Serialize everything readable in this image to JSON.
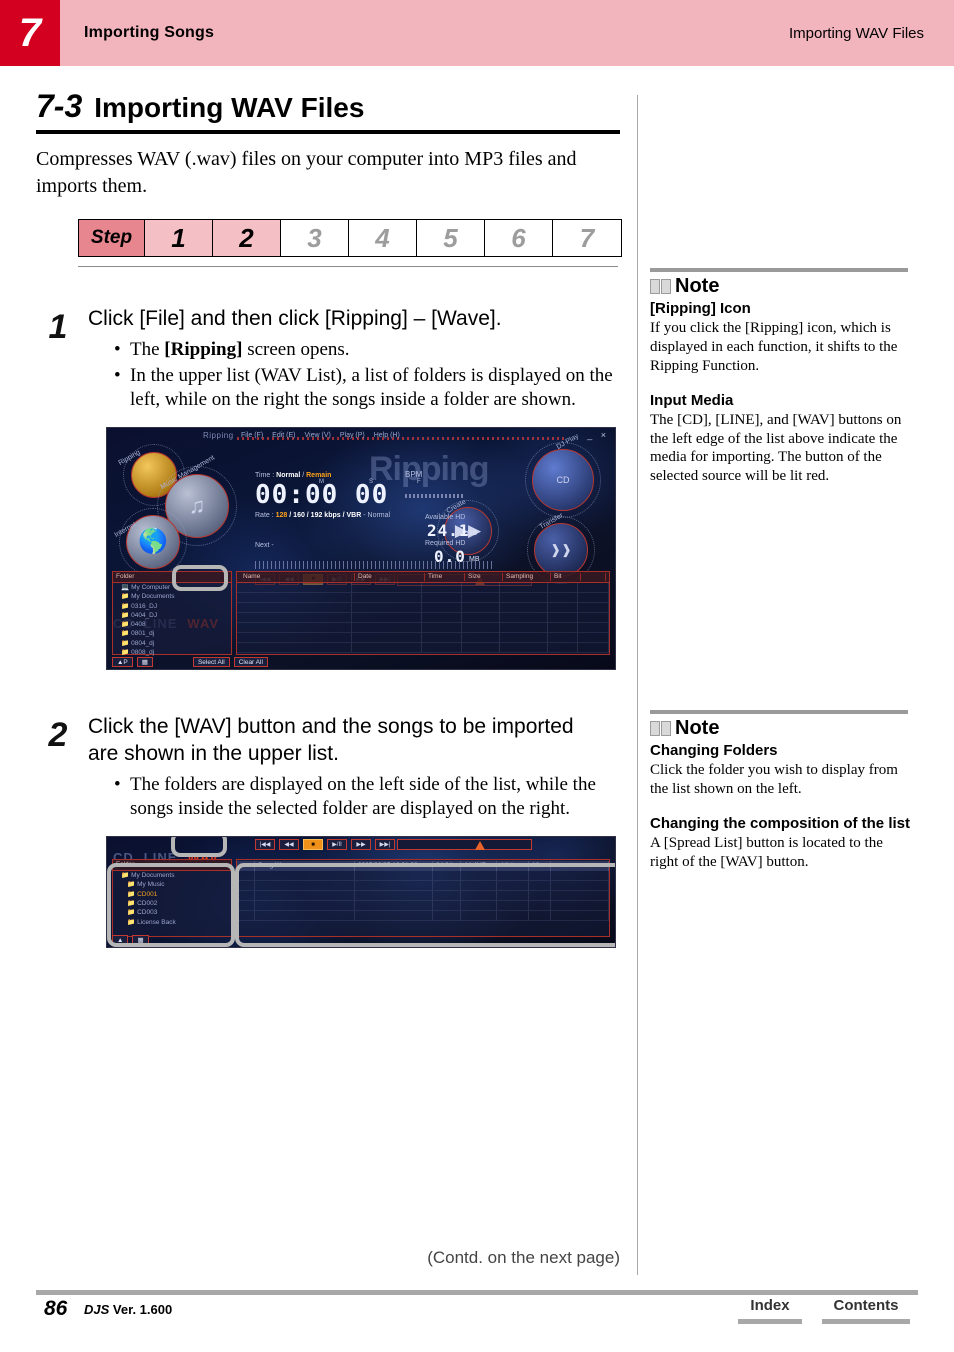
{
  "header": {
    "chapter_number": "7",
    "left_title": "Importing Songs",
    "right_title": "Importing WAV Files"
  },
  "section": {
    "number": "7-3",
    "title": "Importing WAV Files",
    "intro": "Compresses WAV (.wav) files on your computer into MP3 files and imports them."
  },
  "step_bar": {
    "label": "Step",
    "steps": [
      {
        "num": "1",
        "active": true
      },
      {
        "num": "2",
        "active": true
      },
      {
        "num": "3",
        "active": false
      },
      {
        "num": "4",
        "active": false
      },
      {
        "num": "5",
        "active": false
      },
      {
        "num": "6",
        "active": false
      },
      {
        "num": "7",
        "active": false
      }
    ]
  },
  "steps": [
    {
      "marker": "1",
      "heading": "Click [File] and then click [Ripping] – [Wave].",
      "bullets": [
        {
          "pre": "The ",
          "bold": "[Ripping]",
          "post": " screen opens."
        },
        {
          "pre": "In the upper list (WAV List), a list of folders is displayed on the left, while on the right the songs inside a folder are shown.",
          "bold": "",
          "post": ""
        }
      ]
    },
    {
      "marker": "2",
      "heading": "Click the [WAV] button and the songs to be imported are shown in the upper list.",
      "bullets": [
        {
          "pre": "The folders are displayed on the left side of the list, while the songs inside the selected folder are displayed on the right.",
          "bold": "",
          "post": ""
        }
      ]
    }
  ],
  "app_screenshot_1": {
    "window_title": "Ripping",
    "menu": [
      "File (F)",
      "Edit (E)",
      "View (V)",
      "Play (P)",
      "Help (H)"
    ],
    "window_buttons": "_ ×",
    "big_word": "Ripping",
    "nav_icons": [
      {
        "label": "Ripping"
      },
      {
        "label": "Music Management"
      },
      {
        "label": "Internet"
      },
      {
        "label": "DJ Play"
      },
      {
        "label": "Create"
      },
      {
        "label": "Transfer"
      }
    ],
    "time_label": "Time :",
    "time_mode_normal": "Normal",
    "time_mode_remain": "Remain",
    "time_value": "00:00 00",
    "time_units": {
      "m": "M",
      "s": "S",
      "f": "F"
    },
    "rate_label": "Rate :",
    "rate_selected": "128",
    "rate_options": "/ 160 / 192 kbps /",
    "rate_vbr": "VBR",
    "rate_mode": "- Normal",
    "next_label": "Next -",
    "bpm_label": "BPM",
    "available_hd_label": "Available HD",
    "available_hd_value": "24.1",
    "available_hd_unit": "GB",
    "required_hd_label": "Required HD",
    "required_hd_value": "0.0",
    "required_hd_unit": "MB",
    "transport_buttons": [
      "|◀◀",
      "◀◀",
      "■",
      "▶/II",
      "▶▶",
      "▶▶|"
    ],
    "source_buttons": [
      {
        "label": "CD",
        "lit": false
      },
      {
        "label": "LINE",
        "lit": false
      },
      {
        "label": "WAV",
        "lit": true
      }
    ],
    "folder_header": "Folder",
    "folders": [
      "My Computer",
      "My Documents",
      "0316_DJ",
      "0404_DJ",
      "0408",
      "0801_dj",
      "0804_dj",
      "0808_dj"
    ],
    "columns": [
      "Name",
      "Date",
      "Time",
      "Size",
      "Sampling",
      "Bit"
    ],
    "rows": [],
    "bottom_buttons": [
      "Select All",
      "Clear All"
    ],
    "highlight_target": "WAV button"
  },
  "app_screenshot_2": {
    "source_buttons": [
      {
        "label": "CD",
        "lit": false
      },
      {
        "label": "LINE",
        "lit": false
      },
      {
        "label": "WAV",
        "lit": true
      }
    ],
    "folder_header": "Folder",
    "folders": [
      "My Documents",
      "My Music",
      "CD001",
      "CD002",
      "CD003",
      "License Back"
    ],
    "selected_folder": "CD001",
    "columns": [
      "Name",
      "Date",
      "Time",
      "Size",
      "Sampling",
      "Bit"
    ],
    "rows": [
      {
        "name": "Song Wave",
        "date": "2005/08/05 10:01:38",
        "time": "04:24",
        "size": "44.4MB",
        "sampling": "44k/s",
        "bit": "16"
      }
    ],
    "highlight_targets": [
      "WAV button",
      "folder list",
      "song list"
    ]
  },
  "notes": [
    {
      "title": "Note",
      "sections": [
        {
          "subtitle": "[Ripping] Icon",
          "body": "If you click the [Ripping] icon, which is displayed in each function, it shifts to the Ripping Function."
        },
        {
          "subtitle": "Input Media",
          "body": "The [CD], [LINE], and [WAV] buttons on the left edge of the list above indicate the media for importing. The button of the selected source will be lit red."
        }
      ]
    },
    {
      "title": "Note",
      "sections": [
        {
          "subtitle": "Changing Folders",
          "body": "Click the folder you wish to display from the list shown on the left."
        },
        {
          "subtitle": "Changing the composition of the list",
          "body": "A [Spread List] button is located to the right of the [WAV] button."
        }
      ]
    }
  ],
  "footer": {
    "contd": "(Contd. on the next page)",
    "page_number": "86",
    "product": "DJS",
    "version": "Ver. 1.600",
    "index_label": "Index",
    "contents_label": "Contents"
  },
  "colors": {
    "chapter_red": "#d4001f",
    "header_pink": "#f2b4bd",
    "step_label_pink": "#e8868f",
    "step_active_pink": "#f5bfc6",
    "rule_grey": "#a8a8a8"
  }
}
